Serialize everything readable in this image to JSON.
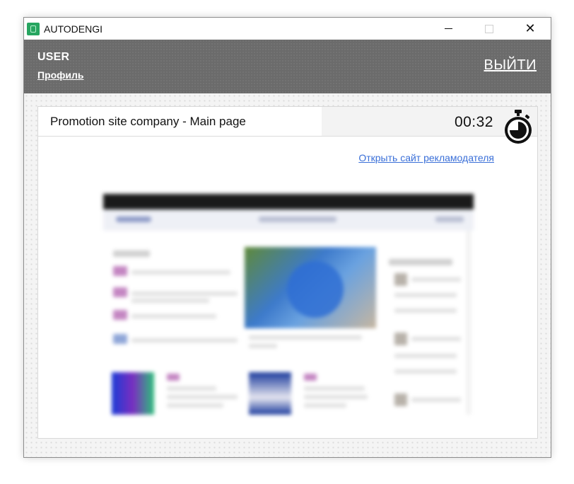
{
  "window": {
    "title": "AUTODENGI",
    "controls": {
      "minimize": "minimize-icon",
      "maximize": "maximize-icon",
      "close": "close-icon"
    }
  },
  "header": {
    "user_name": "USER",
    "profile_link": "Профиль",
    "logout_link": "ВЫЙТИ"
  },
  "task": {
    "title": "Promotion site company - Main page",
    "timer": "00:32",
    "timer_icon": "stopwatch-icon",
    "advertiser_link": "Открыть сайт рекламодателя"
  },
  "colors": {
    "header_bg": "#6b6b6b",
    "link": "#3a6fd8",
    "app_icon": "#27a560"
  }
}
